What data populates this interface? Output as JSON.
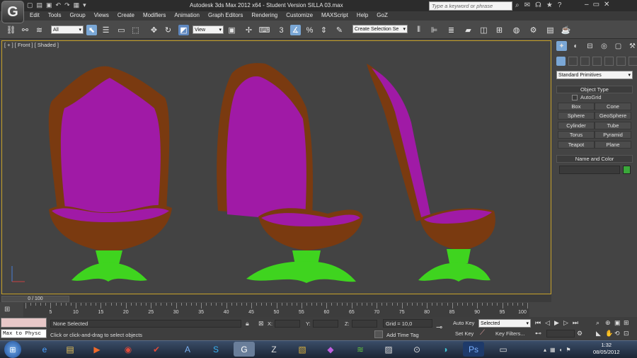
{
  "app": {
    "logo_glyph": "G",
    "title": "Autodesk 3ds Max  2012 x64   - Student Version    SILLA 03.max"
  },
  "search": {
    "placeholder": "Type a keyword or phrase"
  },
  "menu": [
    "Edit",
    "Tools",
    "Group",
    "Views",
    "Create",
    "Modifiers",
    "Animation",
    "Graph Editors",
    "Rendering",
    "Customize",
    "MAXScript",
    "Help",
    "GoZ"
  ],
  "toolbar": {
    "selection_filter": "All",
    "ref_coord": "View",
    "named_selection": "Create Selection Se",
    "snap_label": "3"
  },
  "viewport": {
    "label": "[ + ] [ Front ] [ Shaded ]"
  },
  "command_panel": {
    "dropdown": "Standard Primitives",
    "object_type_title": "Object Type",
    "autogrid_label": "AutoGrid",
    "buttons": [
      "Box",
      "Cone",
      "Sphere",
      "GeoSphere",
      "Cylinder",
      "Tube",
      "Torus",
      "Pyramid",
      "Teapot",
      "Plane"
    ],
    "name_color_title": "Name and Color",
    "swatch_color": "#3aa83a"
  },
  "timeline": {
    "slider": "0 / 100",
    "ticks": [
      "5",
      "10",
      "15",
      "20",
      "25",
      "30",
      "35",
      "40",
      "45",
      "50",
      "55",
      "60",
      "65",
      "70",
      "75",
      "80",
      "85",
      "90",
      "95",
      "100"
    ]
  },
  "status": {
    "maxscript_listener": "Max to Physc",
    "selection": "None Selected",
    "prompt": "Click or click-and-drag to select objects",
    "x_label": "X:",
    "y_label": "Y:",
    "z_label": "Z:",
    "grid": "Grid = 10,0",
    "add_time_tag": "Add Time Tag",
    "auto_key": "Auto Key",
    "selected": "Selected",
    "set_key": "Set Key",
    "key_filters": "Key Filters..."
  },
  "clock": {
    "time": "1:32",
    "date": "08/05/2012"
  },
  "colors": {
    "cushion": "#a01aa6",
    "wood": "#7a3a10",
    "base": "#3fd41f",
    "viewport_border": "#c8a22a"
  }
}
